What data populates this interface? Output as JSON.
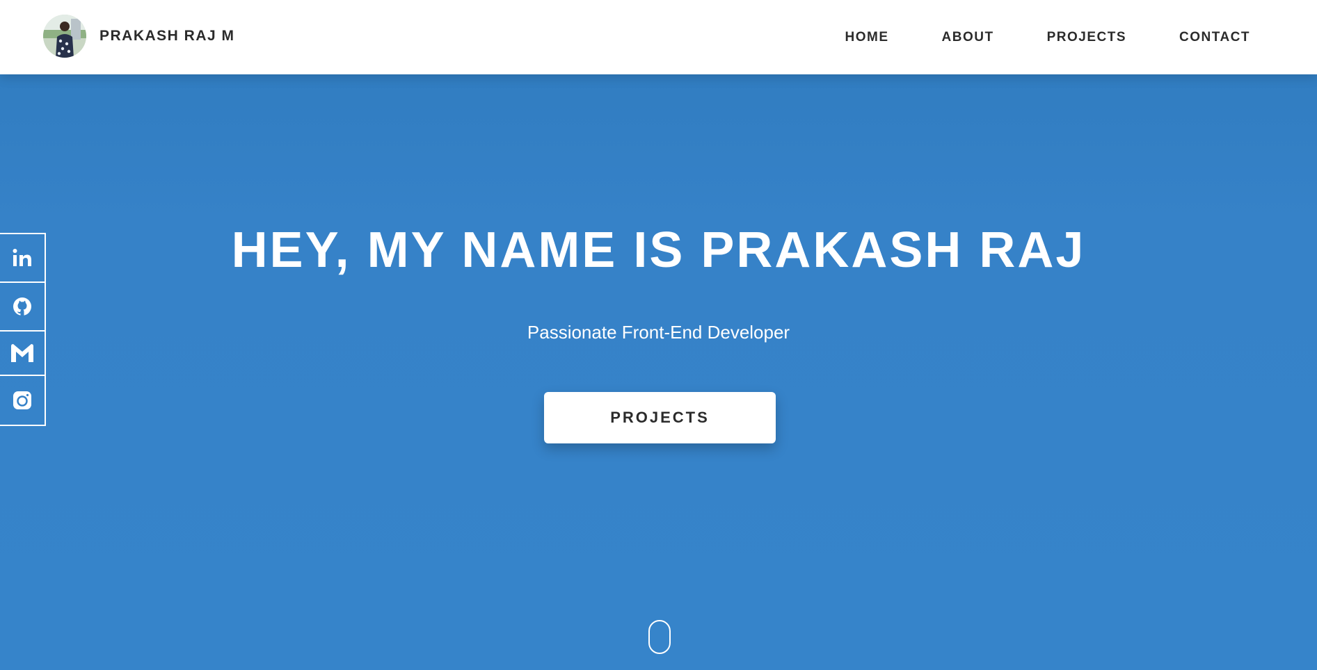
{
  "header": {
    "brand_name": "PRAKASH RAJ M",
    "nav": {
      "home": "HOME",
      "about": "ABOUT",
      "projects": "PROJECTS",
      "contact": "CONTACT"
    }
  },
  "hero": {
    "title": "HEY, MY NAME IS PRAKASH RAJ",
    "subtitle": "Passionate Front-End Developer",
    "cta_label": "PROJECTS"
  },
  "social": {
    "icons": [
      "linkedin-icon",
      "github-icon",
      "gmail-icon",
      "instagram-icon"
    ]
  },
  "colors": {
    "hero_background": "#3682c8",
    "header_background": "#ffffff",
    "text_dark": "#2b2b2b",
    "text_light": "#ffffff"
  }
}
